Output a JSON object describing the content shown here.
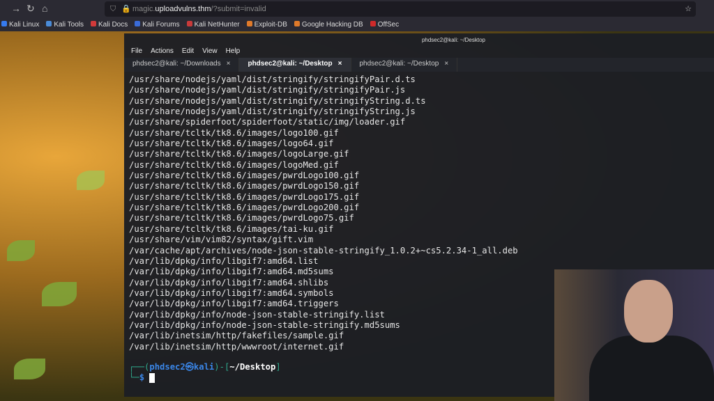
{
  "browser": {
    "url_host_prefix": "magic.",
    "url_host_main": "uploadvulns.thm",
    "url_path": "/?submit=invalid",
    "bookmarks": [
      {
        "label": "Kali Linux",
        "color": "#367bf0"
      },
      {
        "label": "Kali Tools",
        "color": "#4a8bd8"
      },
      {
        "label": "Kali Docs",
        "color": "#d23a3a"
      },
      {
        "label": "Kali Forums",
        "color": "#3a6bd8"
      },
      {
        "label": "Kali NetHunter",
        "color": "#c83a3a"
      },
      {
        "label": "Exploit-DB",
        "color": "#e07a2a"
      },
      {
        "label": "Google Hacking DB",
        "color": "#e07a2a"
      },
      {
        "label": "OffSec",
        "color": "#d02a2a"
      }
    ]
  },
  "terminal": {
    "title": "phdsec2@kali: ~/Desktop",
    "menu": [
      "File",
      "Actions",
      "Edit",
      "View",
      "Help"
    ],
    "tabs": [
      {
        "label": "phdsec2@kali: ~/Downloads"
      },
      {
        "label": "phdsec2@kali: ~/Desktop"
      },
      {
        "label": "phdsec2@kali: ~/Desktop"
      }
    ],
    "output": [
      "/usr/share/nodejs/yaml/dist/stringify/stringifyPair.d.ts",
      "/usr/share/nodejs/yaml/dist/stringify/stringifyPair.js",
      "/usr/share/nodejs/yaml/dist/stringify/stringifyString.d.ts",
      "/usr/share/nodejs/yaml/dist/stringify/stringifyString.js",
      "/usr/share/spiderfoot/spiderfoot/static/img/loader.gif",
      "/usr/share/tcltk/tk8.6/images/logo100.gif",
      "/usr/share/tcltk/tk8.6/images/logo64.gif",
      "/usr/share/tcltk/tk8.6/images/logoLarge.gif",
      "/usr/share/tcltk/tk8.6/images/logoMed.gif",
      "/usr/share/tcltk/tk8.6/images/pwrdLogo100.gif",
      "/usr/share/tcltk/tk8.6/images/pwrdLogo150.gif",
      "/usr/share/tcltk/tk8.6/images/pwrdLogo175.gif",
      "/usr/share/tcltk/tk8.6/images/pwrdLogo200.gif",
      "/usr/share/tcltk/tk8.6/images/pwrdLogo75.gif",
      "/usr/share/tcltk/tk8.6/images/tai-ku.gif",
      "/usr/share/vim/vim82/syntax/gift.vim",
      "/var/cache/apt/archives/node-json-stable-stringify_1.0.2+~cs5.2.34-1_all.deb",
      "/var/lib/dpkg/info/libgif7:amd64.list",
      "/var/lib/dpkg/info/libgif7:amd64.md5sums",
      "/var/lib/dpkg/info/libgif7:amd64.shlibs",
      "/var/lib/dpkg/info/libgif7:amd64.symbols",
      "/var/lib/dpkg/info/libgif7:amd64.triggers",
      "/var/lib/dpkg/info/node-json-stable-stringify.list",
      "/var/lib/dpkg/info/node-json-stable-stringify.md5sums",
      "/var/lib/inetsim/http/fakefiles/sample.gif",
      "/var/lib/inetsim/http/wwwroot/internet.gif"
    ],
    "prompt": {
      "user": "phdsec2",
      "at": "㉿",
      "host": "kali",
      "path": "~/Desktop",
      "symbol": "$"
    }
  }
}
